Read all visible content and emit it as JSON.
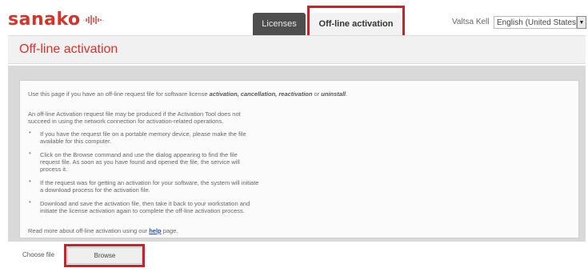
{
  "header": {
    "logo_text": "sanako",
    "tabs": [
      {
        "label": "Licenses"
      },
      {
        "label": "Off-line activation"
      }
    ],
    "user_name": "Valtsa Kell",
    "language": "English (United States)"
  },
  "page_title": "Off-line activation",
  "content": {
    "intro_prefix": "Use this page if you have an off-line request file for software license ",
    "intro_terms": "activation, cancellation, reactivation",
    "intro_or": " or ",
    "intro_last": "uninstall",
    "intro_end": ".",
    "note_line1": "An off-line Activation request file may be produced if the Activation Tool does not",
    "note_line2": "succeed in using the network connection for activation-related operations.",
    "bullets": [
      {
        "lines": [
          "If you have the request file on a portable memory device, please make the file",
          "available for this computer."
        ]
      },
      {
        "lines": [
          "Click on the Browse command and use the dialog appearing to find the file",
          "request file. As soon as you have found and opened the file, the service will",
          "process it."
        ]
      },
      {
        "lines": [
          "If the request was for getting an activation for your software, the system will initiate",
          "a download process for the activation file."
        ]
      },
      {
        "lines": [
          "Download and save the activation file, then take it back to your workstation and",
          "initiate the license activation again to complete the off-line activation process."
        ]
      }
    ],
    "read_more_prefix": "Read more about off-line activation using our ",
    "read_more_link": "help",
    "read_more_suffix": " page."
  },
  "choose_file": {
    "label": "Choose file",
    "button_label": "Browse"
  },
  "colors": {
    "brand": "#d6342b",
    "highlight": "#d11f2a",
    "tab_dark": "#4e4e4e"
  }
}
